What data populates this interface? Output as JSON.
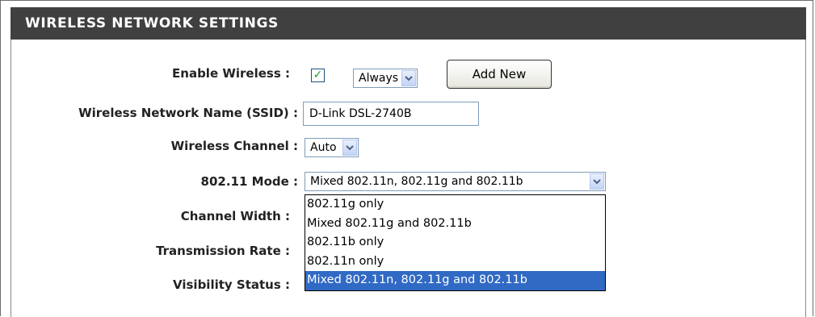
{
  "header": {
    "title": "WIRELESS NETWORK SETTINGS"
  },
  "form": {
    "enable_wireless": {
      "label": "Enable Wireless :",
      "checked": true,
      "check_glyph": "✓",
      "schedule_value": "Always",
      "add_new_label": "Add New"
    },
    "ssid": {
      "label": "Wireless Network Name (SSID) :",
      "value": "D-Link DSL-2740B"
    },
    "channel": {
      "label": "Wireless Channel :",
      "value": "Auto"
    },
    "mode": {
      "label": "802.11 Mode :",
      "value": "Mixed 802.11n, 802.11g and 802.11b",
      "options": [
        "802.11g only",
        "Mixed 802.11g and 802.11b",
        "802.11b only",
        "802.11n only",
        "Mixed 802.11n, 802.11g and 802.11b"
      ],
      "selected_option": "Mixed 802.11n, 802.11g and 802.11b"
    },
    "channel_width": {
      "label": "Channel Width :"
    },
    "transmission_rate": {
      "label": "Transmission Rate :"
    },
    "visibility": {
      "label": "Visibility Status :"
    }
  },
  "colors": {
    "header_bg": "#404040",
    "selection_bg": "#316ac5",
    "check_color": "#21a121"
  },
  "icons": {
    "select_arrow": "chevron-down-icon",
    "checkbox_check": "check-icon"
  }
}
